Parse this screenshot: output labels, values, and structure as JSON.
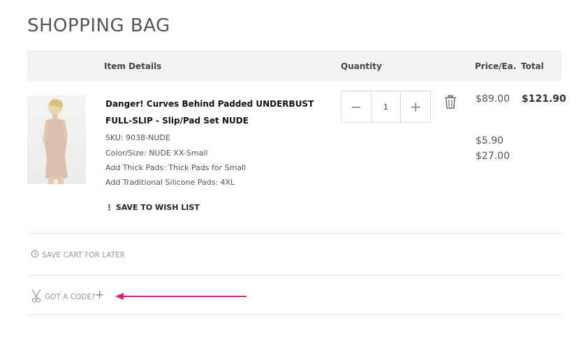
{
  "page": {
    "title": "SHOPPING BAG"
  },
  "table": {
    "headers": {
      "item_details": "Item Details",
      "quantity": "Quantity",
      "price_each": "Price/Ea.",
      "total": "Total"
    }
  },
  "item": {
    "name": "Danger! Curves Behind Padded UNDERBUST FULL-SLIP - Slip/Pad Set NUDE",
    "sku": "SKU: 9038-NUDE",
    "color_size": "Color/Size: NUDE XX-Small",
    "thick_pads": "Add Thick Pads: Thick Pads for Small",
    "silicone_pads": "Add Traditional Silicone Pads: 4XL",
    "wish_list": "⋮ SAVE TO WISH LIST",
    "quantity": "1",
    "price": "$89.00",
    "addon_price_1": "$5.90",
    "addon_price_2": "$27.00",
    "total": "$121.90"
  },
  "actions": {
    "save_cart": "SAVE CART FOR LATER",
    "got_code": "GOT A CODE?",
    "plus": "+",
    "minus": "−",
    "plus_sign": "+"
  },
  "colors": {
    "arrow": "#e6157e"
  }
}
